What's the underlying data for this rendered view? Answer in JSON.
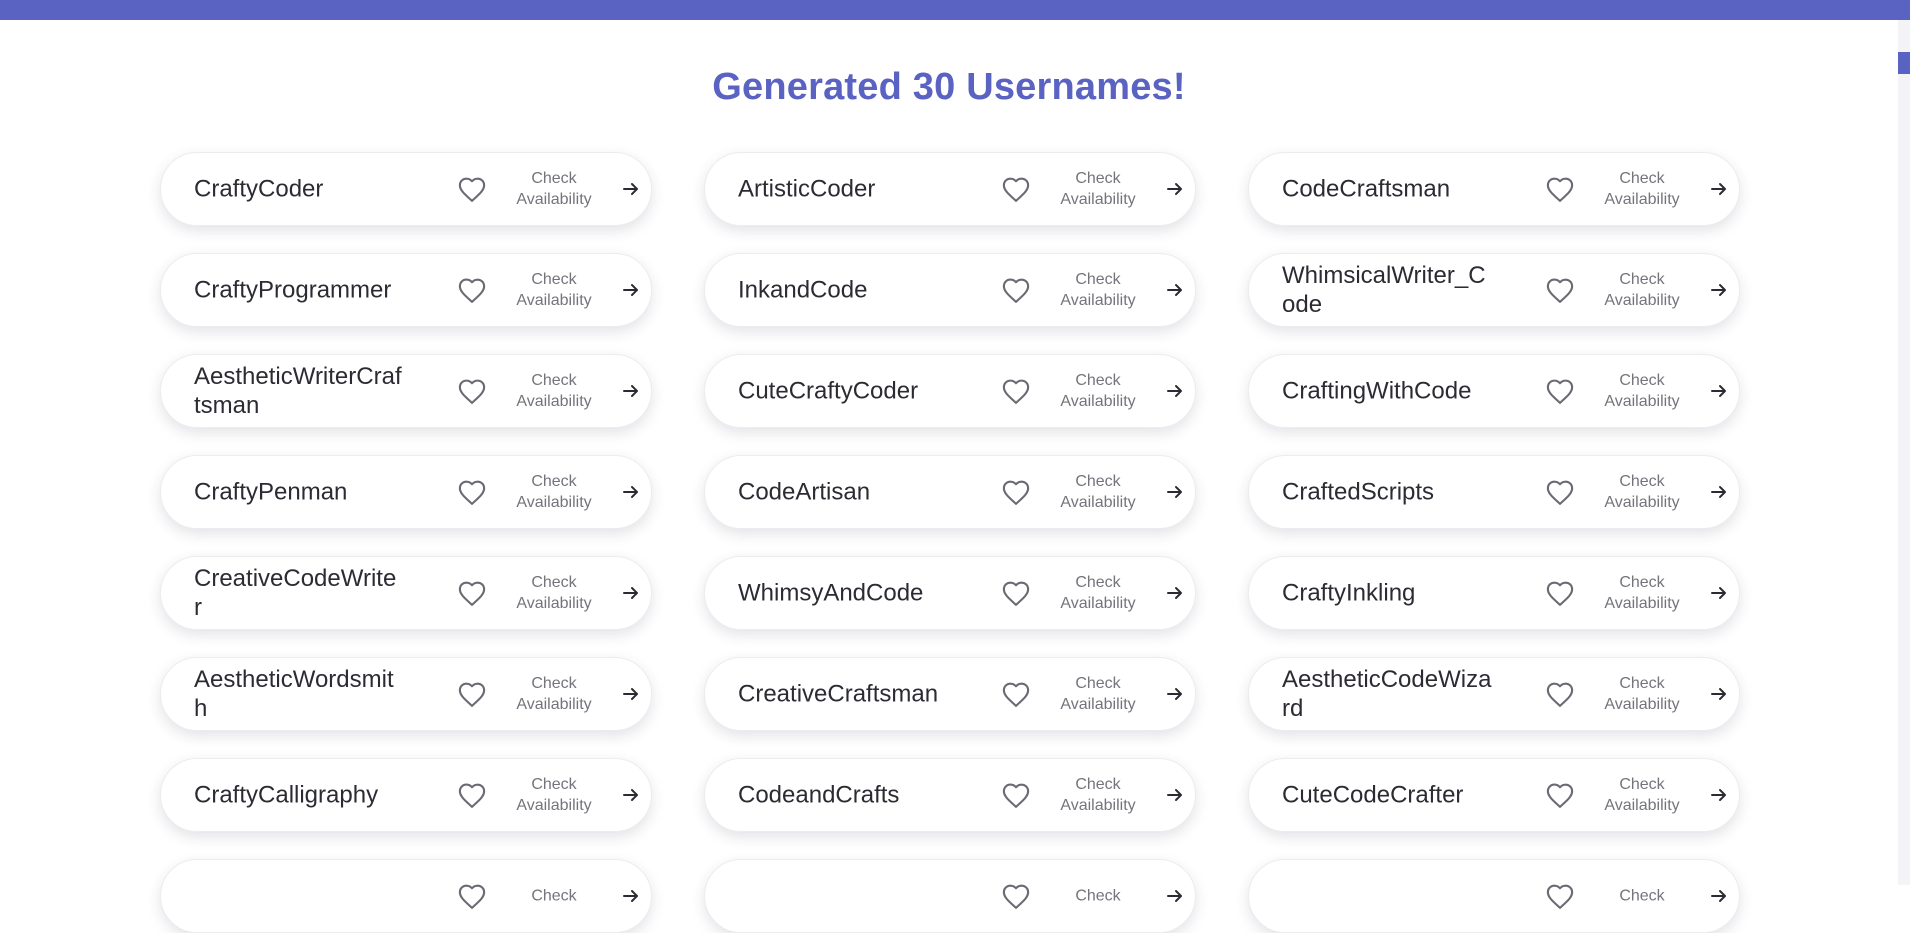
{
  "title": "Generated 30 Usernames!",
  "colors": {
    "accent": "#5a63c1",
    "card_bg": "#ffffff",
    "text": "#2b2b33",
    "muted": "#74747c"
  },
  "icons": {
    "favorite": "heart-outline-icon",
    "go": "arrow-right-icon"
  },
  "cards": [
    {
      "name": "CraftyCoder",
      "action": "Check Availability"
    },
    {
      "name": "ArtisticCoder",
      "action": "Check Availability"
    },
    {
      "name": "CodeCraftsman",
      "action": "Check Availability"
    },
    {
      "name": "CraftyProgrammer",
      "action": "Check Availability"
    },
    {
      "name": "InkandCode",
      "action": "Check Availability"
    },
    {
      "name": "WhimsicalWriter_Code",
      "action": "Check Availability"
    },
    {
      "name": "AestheticWriterCraftsman",
      "action": "Check Availability"
    },
    {
      "name": "CuteCraftyCoder",
      "action": "Check Availability"
    },
    {
      "name": "CraftingWithCode",
      "action": "Check Availability"
    },
    {
      "name": "CraftyPenman",
      "action": "Check Availability"
    },
    {
      "name": "CodeArtisan",
      "action": "Check Availability"
    },
    {
      "name": "CraftedScripts",
      "action": "Check Availability"
    },
    {
      "name": "CreativeCodeWriter",
      "action": "Check Availability"
    },
    {
      "name": "WhimsyAndCode",
      "action": "Check Availability"
    },
    {
      "name": "CraftyInkling",
      "action": "Check Availability"
    },
    {
      "name": "AestheticWordsmith",
      "action": "Check Availability"
    },
    {
      "name": "CreativeCraftsman",
      "action": "Check Availability"
    },
    {
      "name": "AestheticCodeWizard",
      "action": "Check Availability"
    },
    {
      "name": "CraftyCalligraphy",
      "action": "Check Availability"
    },
    {
      "name": "CodeandCrafts",
      "action": "Check Availability"
    },
    {
      "name": "CuteCodeCrafter",
      "action": "Check Availability"
    },
    {
      "name": "",
      "action": "Check"
    },
    {
      "name": "",
      "action": "Check"
    },
    {
      "name": "",
      "action": "Check"
    }
  ]
}
